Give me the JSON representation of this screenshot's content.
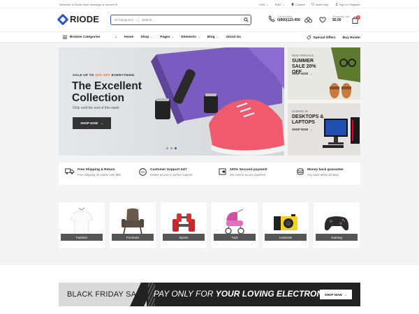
{
  "topbar": {
    "welcome": "Welcome to Riode store message or remove it!",
    "currency": "USD",
    "language": "ENG",
    "contact": "Contact",
    "help": "Need Help",
    "signin": "Sign in / Register"
  },
  "header": {
    "logo": "RIODE",
    "search_category": "All Categories",
    "search_placeholder": "Search...",
    "call_label": "Call Us Now:",
    "call_number": "0(800)123-456",
    "cart_label": "Shopping Cart",
    "cart_amount": "$0.00",
    "cart_count": "0"
  },
  "nav": {
    "browse": "Browse Categories",
    "menu": [
      "Home",
      "Shop",
      "Pages",
      "Elements",
      "Blog",
      "About Us"
    ],
    "special": "Special Offers",
    "buy": "Buy Riode!"
  },
  "hero": {
    "tag_prefix": "SALE UP TO",
    "tag_highlight": "20% OFF",
    "tag_suffix": "EVERYTHING",
    "title": "The Excellent Collection",
    "subtitle": "Only until the end of this week",
    "button": "SHOP NOW",
    "slides": 3,
    "active_slide": 3
  },
  "side_banners": [
    {
      "kicker": "NEW ARRIVALS",
      "title": "SUMMER SALE 20% OFF",
      "button": "SHOP NOW"
    },
    {
      "kicker": "GAMING 4K",
      "title": "DESKTOPS & LAPTOPS",
      "button": "SHOP NOW"
    }
  ],
  "features": [
    {
      "icon": "truck-icon",
      "title": "Free Shipping & Return",
      "sub": "Free shipping on orders over $99"
    },
    {
      "icon": "support-24-icon",
      "title": "Customer Support 24/7",
      "sub": "Instant access to perfect support"
    },
    {
      "icon": "secure-payment-icon",
      "title": "100% Secured payment",
      "sub": "We ensure secure payment"
    },
    {
      "icon": "money-back-icon",
      "title": "Money back guarantee",
      "sub": "Any back within 30 days"
    }
  ],
  "categories": [
    "Fashion",
    "Furniture",
    "Sports",
    "Toys",
    "Cameras",
    "Gaming"
  ],
  "promo": {
    "left": "BLACK FRIDAY SALE!",
    "mid_a": "PAY ONLY FOR",
    "mid_b": "YOUR LOVING ELECTRONICS",
    "button": "SHOP NOW"
  },
  "colors": {
    "accent": "#2d55c9",
    "highlight": "#e06a36",
    "dark": "#333333"
  }
}
